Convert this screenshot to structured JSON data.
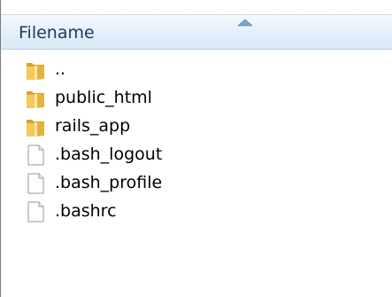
{
  "header": {
    "column_label": "Filename",
    "sort_direction": "ascending"
  },
  "files": [
    {
      "name": "..",
      "type": "folder",
      "icon": "folder-icon"
    },
    {
      "name": "public_html",
      "type": "folder",
      "icon": "folder-icon"
    },
    {
      "name": "rails_app",
      "type": "folder",
      "icon": "folder-icon"
    },
    {
      "name": ".bash_logout",
      "type": "file",
      "icon": "file-icon"
    },
    {
      "name": ".bash_profile",
      "type": "file",
      "icon": "file-icon"
    },
    {
      "name": ".bashrc",
      "type": "file",
      "icon": "file-icon"
    }
  ],
  "colors": {
    "header_text": "#1e395b",
    "folder": "#e8b53a",
    "file_border": "#9a9a9a"
  }
}
